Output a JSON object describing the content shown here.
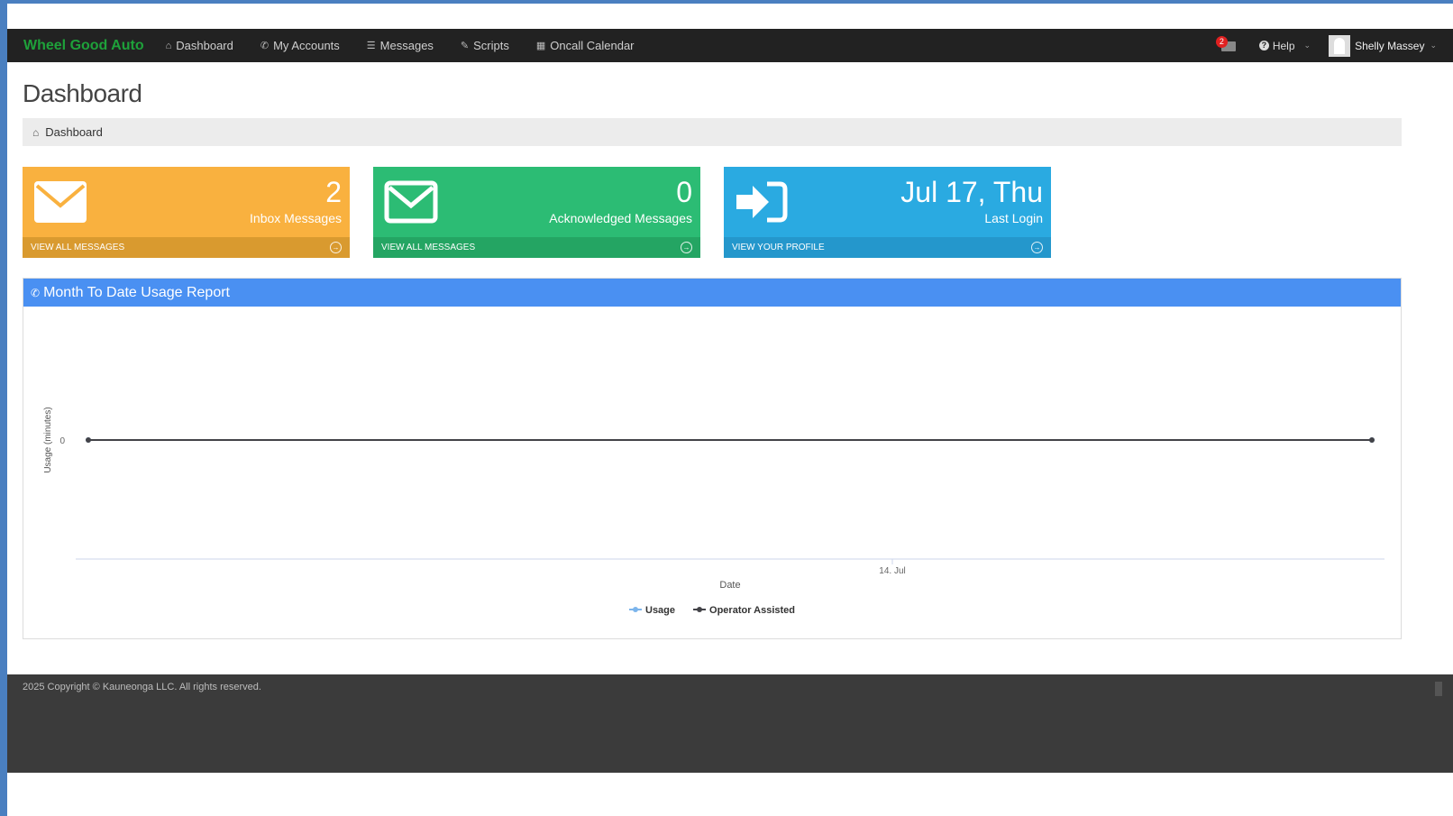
{
  "nav": {
    "brand": "Wheel Good Auto",
    "items": [
      {
        "label": "Dashboard",
        "icon": "home-icon"
      },
      {
        "label": "My Accounts",
        "icon": "phone-icon"
      },
      {
        "label": "Messages",
        "icon": "list-icon"
      },
      {
        "label": "Scripts",
        "icon": "edit-icon"
      },
      {
        "label": "Oncall Calendar",
        "icon": "calendar-icon"
      }
    ],
    "notification_count": "2",
    "help_label": "Help",
    "user_name": "Shelly Massey"
  },
  "page": {
    "title": "Dashboard",
    "breadcrumb": "Dashboard"
  },
  "cards": [
    {
      "number": "2",
      "label": "Inbox Messages",
      "link": "VIEW ALL MESSAGES",
      "icon": "envelope-icon",
      "color": "#f9b13f"
    },
    {
      "number": "0",
      "label": "Acknowledged Messages",
      "link": "VIEW ALL MESSAGES",
      "icon": "envelope-icon",
      "color": "#2cbc74"
    },
    {
      "number": "Jul 17, Thu",
      "label": "Last Login",
      "link": "VIEW YOUR PROFILE",
      "icon": "sign-in-icon",
      "color": "#2aaae1"
    }
  ],
  "usage_panel": {
    "title": "Month To Date Usage Report"
  },
  "chart_data": {
    "type": "line",
    "xlabel": "Date",
    "ylabel": "Usage (minutes)",
    "x_tick_labels": [
      "14. Jul"
    ],
    "y_tick_labels": [
      "0"
    ],
    "series": [
      {
        "name": "Usage",
        "color": "#7cb5ec",
        "values": [
          0,
          0
        ]
      },
      {
        "name": "Operator Assisted",
        "color": "#434348",
        "values": [
          0,
          0
        ]
      }
    ],
    "legend": "bottom-center"
  },
  "footer": {
    "copyright": "2025 Copyright © Kauneonga LLC. All rights reserved."
  }
}
